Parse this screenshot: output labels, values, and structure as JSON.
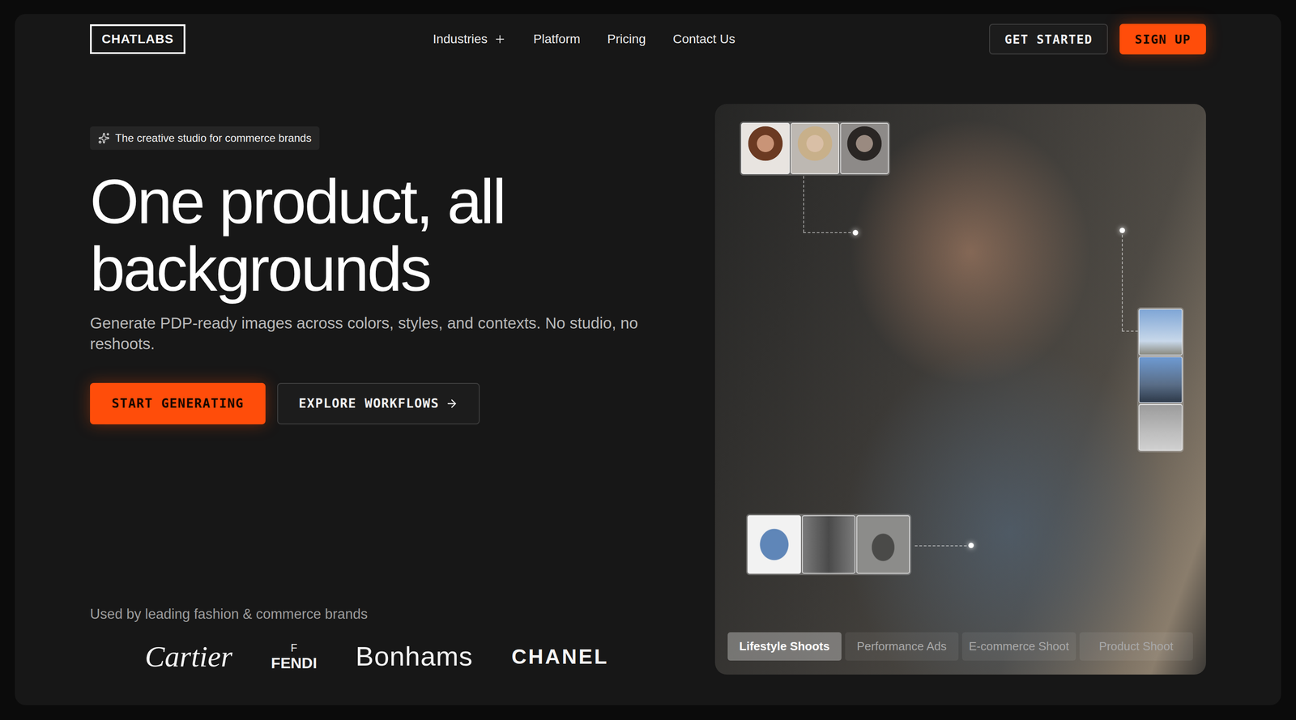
{
  "nav": {
    "logo": "CHATLABS",
    "links": [
      {
        "label": "Industries",
        "expandable": true
      },
      {
        "label": "Platform",
        "expandable": false
      },
      {
        "label": "Pricing",
        "expandable": false
      },
      {
        "label": "Contact Us",
        "expandable": false
      }
    ],
    "actions": [
      {
        "label": "GET STARTED",
        "kind": "secondary"
      },
      {
        "label": "SIGN UP",
        "kind": "primary"
      }
    ]
  },
  "hero": {
    "badge": "The creative studio for commerce brands",
    "title_lines": [
      "One product, all",
      "backgrounds"
    ],
    "subtitle": "Generate PDP-ready images across colors, styles, and contexts. No studio, no reshoots.",
    "buttons": [
      {
        "label": "START GENERATING",
        "kind": "primary"
      },
      {
        "label": "EXPLORE WORKFLOWS",
        "kind": "secondary"
      }
    ]
  },
  "clients": {
    "caption": "Used by leading fashion & commerce brands",
    "logos": [
      {
        "name": "Cartier",
        "mark": "",
        "kind": "script"
      },
      {
        "name": "FENDI",
        "mark": "F",
        "kind": "stacked"
      },
      {
        "name": "Bonhams",
        "mark": "",
        "kind": "sans"
      },
      {
        "name": "CHANEL",
        "mark": "",
        "kind": "wide"
      }
    ]
  },
  "showcase": {
    "tabs": [
      {
        "label": "Lifestyle Shoots",
        "selected": true
      },
      {
        "label": "Performance Ads",
        "selected": false
      },
      {
        "label": "E-commerce Shoot",
        "selected": false
      },
      {
        "label": "Product Shoot",
        "selected": false
      }
    ]
  }
}
